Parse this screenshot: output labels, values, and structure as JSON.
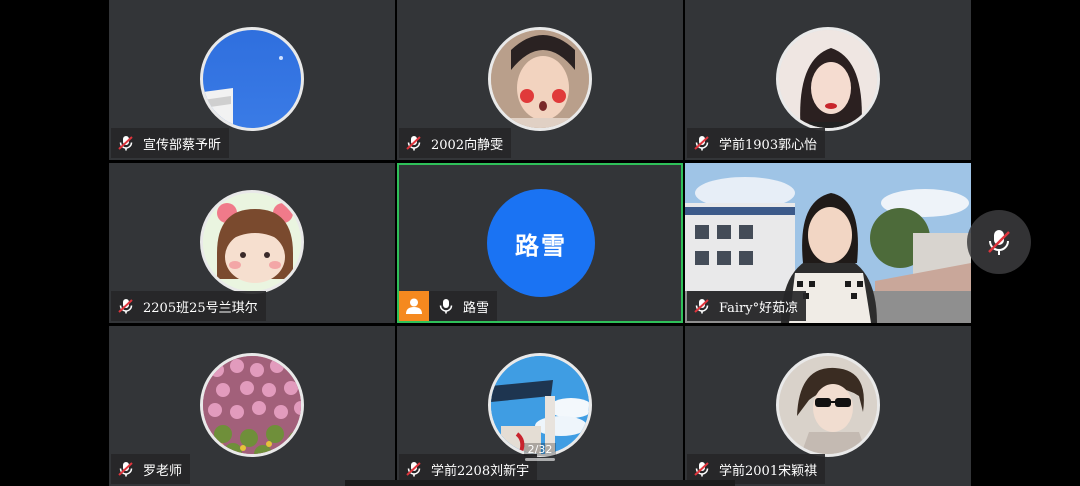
{
  "participants": [
    {
      "name": "宣传部蔡予昕",
      "mic": "muted",
      "avatar": "blue-sky-avatar"
    },
    {
      "name": "2002向静雯",
      "mic": "muted",
      "avatar": "portrait-avatar"
    },
    {
      "name": "学前1903郭心怡",
      "mic": "muted",
      "avatar": "portrait-avatar"
    },
    {
      "name": "2205班25号兰琪尔",
      "mic": "muted",
      "avatar": "cartoon-girl-avatar"
    },
    {
      "name": "路雪",
      "mic": "on",
      "avatar": "name-initials-avatar",
      "initials": "路雪",
      "is_host": true,
      "active_speaker": true
    },
    {
      "name": "Fairy°好茹凉",
      "mic": "muted",
      "avatar": "video-feed"
    },
    {
      "name": "罗老师",
      "mic": "muted",
      "avatar": "flower-avatar"
    },
    {
      "name": "学前2208刘新宇",
      "mic": "muted",
      "avatar": "building-avatar"
    },
    {
      "name": "学前2001宋颖祺",
      "mic": "muted",
      "avatar": "portrait-avatar"
    }
  ],
  "pagination": {
    "label": "2/32"
  },
  "colors": {
    "active_border": "#2fc15a",
    "host_badge": "#f5891f",
    "initials_bg": "#1a73f3",
    "muted_red": "#e0353d"
  }
}
